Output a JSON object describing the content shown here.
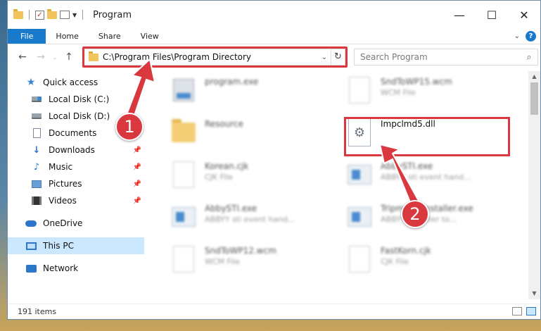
{
  "titlebar": {
    "title": "Program",
    "minimize": "—",
    "maximize": "☐",
    "close": "✕"
  },
  "ribbon": {
    "tabs": [
      "File",
      "Home",
      "Share",
      "View"
    ],
    "help": "?"
  },
  "nav": {
    "back": "←",
    "forward": "→",
    "up": "↑",
    "address": "C:\\Program Files\\Program Directory",
    "search_placeholder": "Search Program"
  },
  "sidebar": {
    "items": [
      {
        "label": "Quick access",
        "icon": "star-icon"
      },
      {
        "label": "Local Disk (C:)",
        "icon": "windows-disk-icon"
      },
      {
        "label": "Local Disk (D:)",
        "icon": "disk-icon"
      },
      {
        "label": "Documents",
        "icon": "documents-icon"
      },
      {
        "label": "Downloads",
        "icon": "downloads-icon"
      },
      {
        "label": "Music",
        "icon": "music-icon"
      },
      {
        "label": "Pictures",
        "icon": "pictures-icon"
      },
      {
        "label": "Videos",
        "icon": "videos-icon"
      },
      {
        "label": "OneDrive",
        "icon": "onedrive-icon"
      },
      {
        "label": "This PC",
        "icon": "this-pc-icon"
      },
      {
        "label": "Network",
        "icon": "network-icon"
      }
    ]
  },
  "files": [
    {
      "name": "program.exe",
      "sub": ""
    },
    {
      "name": "SndToWP15.wcm",
      "sub": "WCM File"
    },
    {
      "name": "Resource",
      "sub": ""
    },
    {
      "name": "Impclmd5.dll",
      "sub": ""
    },
    {
      "name": "Korean.cjk",
      "sub": "CJK File"
    },
    {
      "name": "AbbySTI.exe",
      "sub": "ABBYY sti event hand..."
    },
    {
      "name": "AbbySTI.exe",
      "sub": "ABBYY sti event hand..."
    },
    {
      "name": "Tripmode Installer.exe",
      "sub": "ABBYY Installer to..."
    },
    {
      "name": "SndToWP12.wcm",
      "sub": "WCM File"
    },
    {
      "name": "FastKorn.cjk",
      "sub": "CJK File"
    }
  ],
  "status": {
    "count": "191 items"
  },
  "annotations": {
    "step1": "1",
    "step2": "2"
  },
  "colors": {
    "accent": "#1979ca",
    "highlight": "#d9383f",
    "selection": "#cce8ff"
  }
}
